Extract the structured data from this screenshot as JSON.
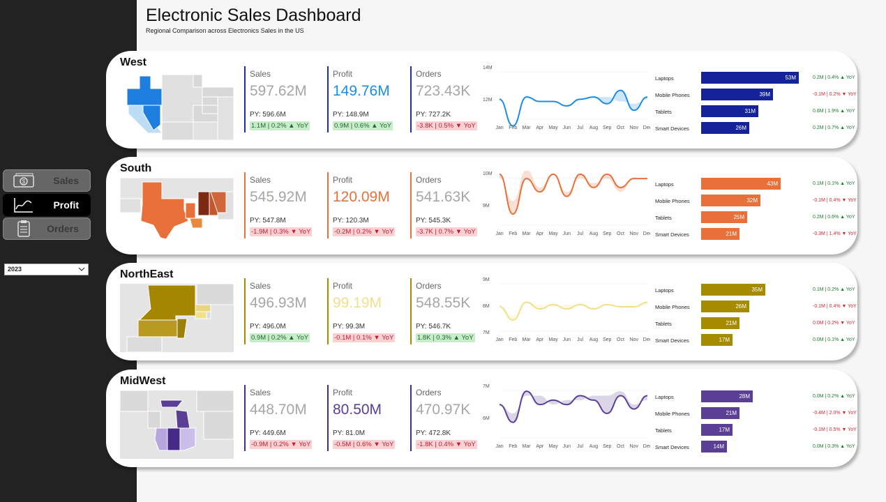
{
  "header": {
    "title": "Electronic Sales Dashboard",
    "subtitle": "Regional Comparison across Electronics Sales in the US"
  },
  "nav": [
    {
      "label": "Sales",
      "icon": "cash-icon",
      "active": false
    },
    {
      "label": "Profit",
      "icon": "line-chart-icon",
      "active": true
    },
    {
      "label": "Orders",
      "icon": "clipboard-icon",
      "active": false
    }
  ],
  "year_filter": {
    "value": "2023"
  },
  "months": [
    "Jan",
    "Feb",
    "Mar",
    "Apr",
    "May",
    "Jun",
    "Jul",
    "Aug",
    "Sep",
    "Oct",
    "Nov",
    "Dec"
  ],
  "regions": [
    {
      "name": "West",
      "color": "#1a8ce8",
      "kpi_border": "#1a2fa0",
      "kpis": [
        {
          "label": "Sales",
          "value": "597.62M",
          "py": "PY: 596.6M",
          "delta": "1.1M | 0.2% ▲ YoY",
          "dir": "pos",
          "highlight": false
        },
        {
          "label": "Profit",
          "value": "149.76M",
          "py": "PY: 148.9M",
          "delta": "0.9M | 0.6% ▲ YoY",
          "dir": "pos",
          "highlight": true
        },
        {
          "label": "Orders",
          "value": "723.43K",
          "py": "PY: 727.2K",
          "delta": "-3.8K | 0.5% ▼ YoY",
          "dir": "neg",
          "highlight": false
        }
      ],
      "trend_axis": [
        "14M",
        "12M"
      ],
      "bar_color": "#15239b",
      "products": [
        {
          "name": "Laptops",
          "value": 53,
          "label": "53M",
          "yoy": "0.2M | 0.4% ▲ YoY",
          "dir": "pos"
        },
        {
          "name": "Mobile Phones",
          "value": 39,
          "label": "39M",
          "yoy": "-0.1M | 0.2% ▼ YoY",
          "dir": "neg"
        },
        {
          "name": "Tablets",
          "value": 31,
          "label": "31M",
          "yoy": "0.6M | 1.9% ▲ YoY",
          "dir": "pos"
        },
        {
          "name": "Smart Devices",
          "value": 26,
          "label": "26M",
          "yoy": "0.2M | 0.7% ▲ YoY",
          "dir": "pos"
        }
      ]
    },
    {
      "name": "South",
      "color": "#e8703a",
      "kpi_border": "#e8703a",
      "kpis": [
        {
          "label": "Sales",
          "value": "545.92M",
          "py": "PY: 547.8M",
          "delta": "-1.9M | 0.3% ▼ YoY",
          "dir": "neg",
          "highlight": false
        },
        {
          "label": "Profit",
          "value": "120.09M",
          "py": "PY: 120.3M",
          "delta": "-0.2M | 0.2% ▼ YoY",
          "dir": "neg",
          "highlight": true
        },
        {
          "label": "Orders",
          "value": "541.63K",
          "py": "PY: 545.3K",
          "delta": "-3.7K | 0.7% ▼ YoY",
          "dir": "neg",
          "highlight": false
        }
      ],
      "trend_axis": [
        "10M",
        "9M"
      ],
      "bar_color": "#e8703a",
      "products": [
        {
          "name": "Laptops",
          "value": 43,
          "label": "43M",
          "yoy": "0.1M | 0.1% ▲ YoY",
          "dir": "pos"
        },
        {
          "name": "Mobile Phones",
          "value": 32,
          "label": "32M",
          "yoy": "-0.1M | 0.4% ▼ YoY",
          "dir": "neg"
        },
        {
          "name": "Tablets",
          "value": 25,
          "label": "25M",
          "yoy": "0.2M | 0.6% ▲ YoY",
          "dir": "pos"
        },
        {
          "name": "Smart Devices",
          "value": 21,
          "label": "21M",
          "yoy": "-0.3M | 1.4% ▼ YoY",
          "dir": "neg"
        }
      ]
    },
    {
      "name": "NorthEast",
      "color": "#f2df8a",
      "kpi_border": "#a68a00",
      "kpis": [
        {
          "label": "Sales",
          "value": "496.93M",
          "py": "PY: 496.0M",
          "delta": "0.9M | 0.2% ▲ YoY",
          "dir": "pos",
          "highlight": false
        },
        {
          "label": "Profit",
          "value": "99.19M",
          "py": "PY: 99.3M",
          "delta": "-0.1M | 0.1% ▼ YoY",
          "dir": "neg",
          "highlight": true
        },
        {
          "label": "Orders",
          "value": "548.55K",
          "py": "PY: 546.7K",
          "delta": "1.8K | 0.3% ▲ YoY",
          "dir": "pos",
          "highlight": false
        }
      ],
      "trend_axis": [
        "9M",
        "8M",
        "7M"
      ],
      "bar_color": "#a68a00",
      "products": [
        {
          "name": "Laptops",
          "value": 35,
          "label": "35M",
          "yoy": "0.1M | 0.2% ▲ YoY",
          "dir": "pos"
        },
        {
          "name": "Mobile Phones",
          "value": 26,
          "label": "26M",
          "yoy": "-0.1M | 0.4% ▼ YoY",
          "dir": "neg"
        },
        {
          "name": "Tablets",
          "value": 21,
          "label": "21M",
          "yoy": "0.0M | 0.2% ▼ YoY",
          "dir": "neg"
        },
        {
          "name": "Smart Devices",
          "value": 17,
          "label": "17M",
          "yoy": "0.0M | 0.1% ▲ YoY",
          "dir": "pos"
        }
      ]
    },
    {
      "name": "MidWest",
      "color": "#5b3e96",
      "kpi_border": "#3f2d8a",
      "kpis": [
        {
          "label": "Sales",
          "value": "448.70M",
          "py": "PY: 449.6M",
          "delta": "-0.9M | 0.2% ▼ YoY",
          "dir": "neg",
          "highlight": false
        },
        {
          "label": "Profit",
          "value": "80.50M",
          "py": "PY: 81.0M",
          "delta": "-0.5M | 0.6% ▼ YoY",
          "dir": "neg",
          "highlight": true
        },
        {
          "label": "Orders",
          "value": "470.97K",
          "py": "PY: 472.8K",
          "delta": "-1.8K | 0.4% ▼ YoY",
          "dir": "neg",
          "highlight": false
        }
      ],
      "trend_axis": [
        "7M",
        "6M"
      ],
      "bar_color": "#5b3e96",
      "products": [
        {
          "name": "Laptops",
          "value": 28,
          "label": "28M",
          "yoy": "0.0M | 0.2% ▲ YoY",
          "dir": "pos"
        },
        {
          "name": "Mobile Phones",
          "value": 21,
          "label": "21M",
          "yoy": "-0.4M | 2.0% ▼ YoY",
          "dir": "neg"
        },
        {
          "name": "Tablets",
          "value": 17,
          "label": "17M",
          "yoy": "-0.1M | 0.5% ▼ YoY",
          "dir": "neg"
        },
        {
          "name": "Smart Devices",
          "value": 14,
          "label": "14M",
          "yoy": "0.0M | 0.3% ▲ YoY",
          "dir": "pos"
        }
      ]
    }
  ]
}
